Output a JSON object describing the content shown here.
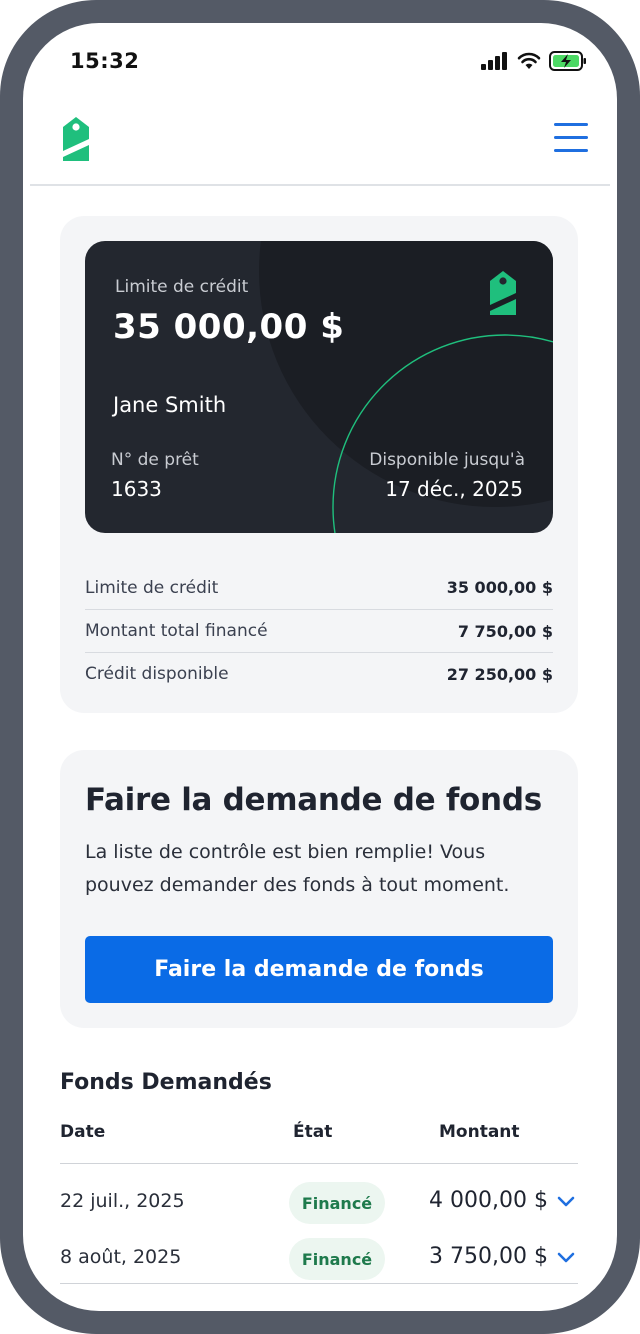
{
  "status_bar": {
    "time": "15:32"
  },
  "credit_card": {
    "label": "Limite de crédit",
    "limit": "35 000,00 $",
    "holder_name": "Jane Smith",
    "loan_label": "N° de prêt",
    "loan_number": "1633",
    "available_label": "Disponible jusqu'à",
    "available_date": "17 déc., 2025"
  },
  "summary": [
    {
      "label": "Limite de crédit",
      "value": "35 000,00 $"
    },
    {
      "label": "Montant total financé",
      "value": "7 750,00 $"
    },
    {
      "label": "Crédit disponible",
      "value": "27 250,00 $"
    }
  ],
  "funds_request": {
    "title": "Faire la demande de fonds",
    "text": "La liste de contrôle est bien remplie! Vous pouvez demander des fonds à tout moment.",
    "button_label": "Faire la demande de fonds"
  },
  "requested_funds": {
    "title": "Fonds Demandés",
    "columns": {
      "date": "Date",
      "state": "État",
      "amount": "Montant"
    },
    "rows": [
      {
        "date": "22 juil., 2025",
        "state": "Financé",
        "amount": "4 000,00 $"
      },
      {
        "date": "8 août, 2025",
        "state": "Financé",
        "amount": "3 750,00 $"
      }
    ]
  },
  "colors": {
    "brand_green": "#1fbf7d",
    "primary_blue": "#0a6be6",
    "card_dark": "#23272f",
    "frame": "#545a66"
  }
}
